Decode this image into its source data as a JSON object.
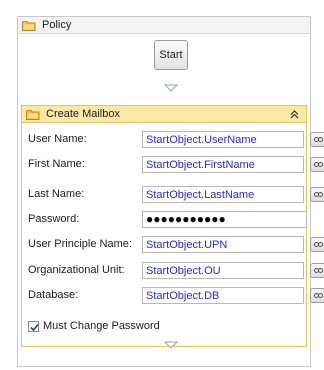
{
  "workflow": {
    "title": "Policy",
    "start_label": "Start"
  },
  "activity": {
    "title": "Create Mailbox",
    "fields": [
      {
        "label": "User Name:",
        "value": "StartObject.UserName"
      },
      {
        "label": "First Name:",
        "value": "StartObject.FirstName"
      },
      {
        "label": "Last Name:",
        "value": "StartObject.LastName"
      },
      {
        "label": "Password:",
        "value": "●●●●●●●●●●●"
      },
      {
        "label": "User Principle Name:",
        "value": "StartObject.UPN"
      },
      {
        "label": "Organizational Unit:",
        "value": "StartObject.OU"
      },
      {
        "label": "Database:",
        "value": "StartObject.DB"
      }
    ],
    "checkbox": {
      "label": "Must Change Password",
      "checked": true
    }
  },
  "icons": {
    "header": "folder-icon",
    "collapse": "double-chevron-up-icon",
    "expression": "expression-editor-icon",
    "flow": "down-arrow-icon"
  },
  "colors": {
    "activity_header_bg": "#fde9a6",
    "activity_border": "#e6c55a",
    "value_text": "#2b2bc5"
  }
}
